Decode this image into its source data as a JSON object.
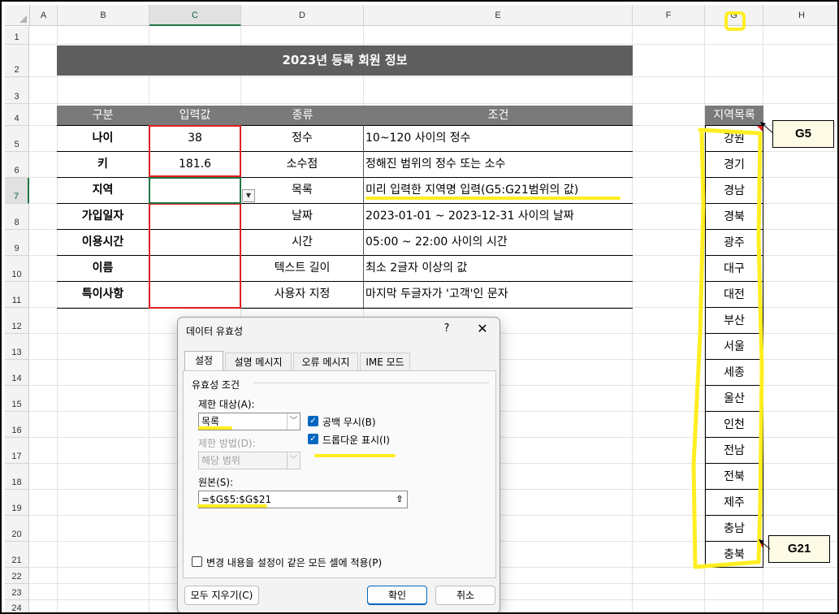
{
  "columns": [
    "A",
    "B",
    "C",
    "D",
    "E",
    "F",
    "G",
    "H"
  ],
  "rows": [
    "1",
    "2",
    "3",
    "4",
    "5",
    "6",
    "7",
    "8",
    "9",
    "10",
    "11",
    "12",
    "13",
    "14",
    "15",
    "16",
    "17",
    "18",
    "19",
    "20",
    "21",
    "22",
    "23",
    "24"
  ],
  "sheet": {
    "title": "2023년 등록 회원 정보",
    "headers": [
      "구분",
      "입력값",
      "종류",
      "조건"
    ],
    "table_rows": [
      {
        "label": "나이",
        "value": "38",
        "type": "정수",
        "condition": "10~120 사이의 정수"
      },
      {
        "label": "키",
        "value": "181.6",
        "type": "소수점",
        "condition": "정해진 범위의 정수 또는 소수"
      },
      {
        "label": "지역",
        "value": "",
        "type": "목록",
        "condition": "미리 입력한 지역명 입력(G5:G21범위의 값)"
      },
      {
        "label": "가입일자",
        "value": "",
        "type": "날짜",
        "condition": "2023-01-01 ~ 2023-12-31 사이의 날짜"
      },
      {
        "label": "이용시간",
        "value": "",
        "type": "시간",
        "condition": "05:00 ~ 22:00 사이의 시간"
      },
      {
        "label": "이름",
        "value": "",
        "type": "텍스트 길이",
        "condition": "최소 2글자 이상의 값"
      },
      {
        "label": "특이사항",
        "value": "",
        "type": "사용자 지정",
        "condition": "마지막 두글자가 '고객'인 문자"
      }
    ],
    "region_header": "지역목록",
    "regions": [
      "강원",
      "경기",
      "경남",
      "경북",
      "광주",
      "대구",
      "대전",
      "부산",
      "서울",
      "세종",
      "울산",
      "인천",
      "전남",
      "전북",
      "제주",
      "충남",
      "충북"
    ],
    "callout_top": "G5",
    "callout_bottom": "G21"
  },
  "dialog": {
    "title": "데이터 유효성",
    "help": "?",
    "close": "✕",
    "tabs": [
      "설정",
      "설명 메시지",
      "오류 메시지",
      "IME 모드"
    ],
    "section": "유효성 조건",
    "allow_label": "제한 대상(A):",
    "allow_value": "목록",
    "data_label": "제한 방법(D):",
    "data_value": "해당 범위",
    "ignore_blank": "공백 무시(B)",
    "dropdown": "드롭다운 표시(I)",
    "source_label": "원본(S):",
    "source_value": "=$G$5:$G$21",
    "apply_all": "변경 내용을 설정이 같은 모든 셀에 적용(P)",
    "clear_all": "모두 지우기(C)",
    "ok": "확인",
    "cancel": "취소"
  }
}
